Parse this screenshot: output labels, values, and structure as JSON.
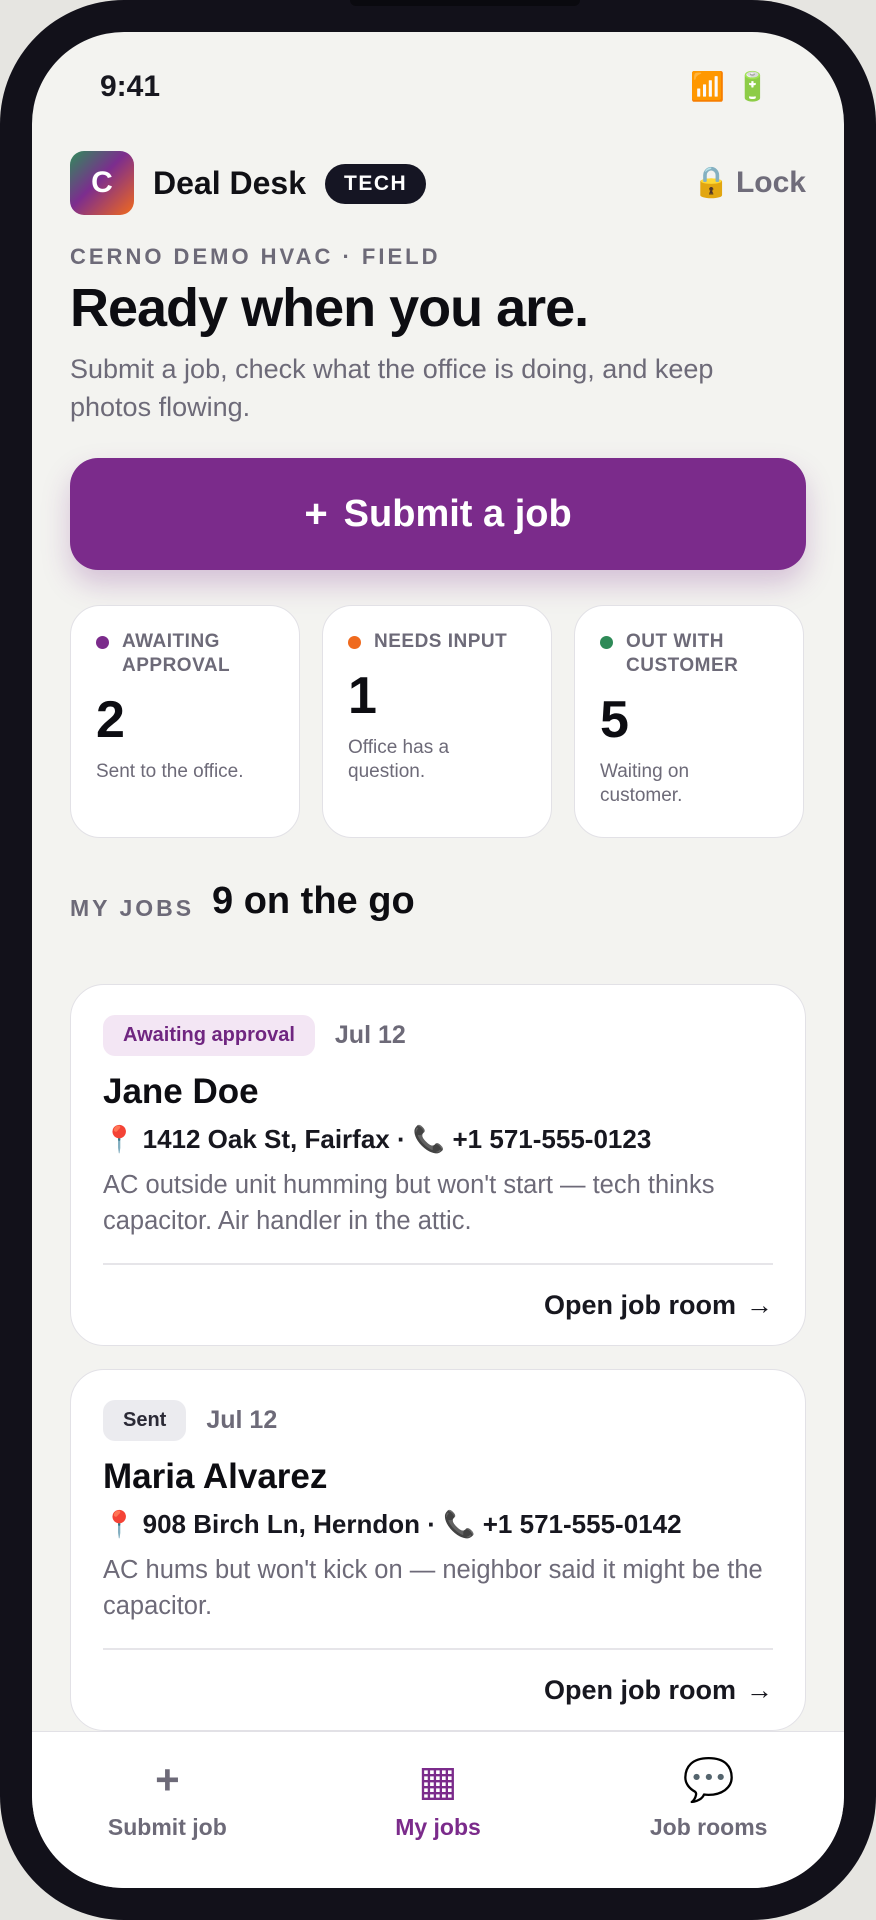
{
  "status_bar": {
    "time": "9:41",
    "wifi_icon": "📶",
    "battery_icon": "🔋"
  },
  "header": {
    "logo_letter": "C",
    "app_name": "Deal Desk",
    "role_badge": "TECH",
    "lock_icon": "🔒",
    "lock_label": "Lock"
  },
  "intro": {
    "eyebrow": "CERNO DEMO HVAC · FIELD",
    "title": "Ready when you are.",
    "subtitle": "Submit a job, check what the office is doing, and keep photos flowing."
  },
  "submit_button": {
    "icon": "+",
    "label": "Submit a job"
  },
  "stats": [
    {
      "label": "AWAITING APPROVAL",
      "value": "2",
      "description": "Sent to the office.",
      "dot_color": "#7b2b8b"
    },
    {
      "label": "NEEDS INPUT",
      "value": "1",
      "description": "Office has a question.",
      "dot_color": "#ef6a1e"
    },
    {
      "label": "OUT WITH CUSTOMER",
      "value": "5",
      "description": "Waiting on customer.",
      "dot_color": "#2e8a57"
    }
  ],
  "my_jobs": {
    "label": "MY JOBS",
    "title": "9 on the go",
    "jobs": [
      {
        "status": "Awaiting approval",
        "status_bg": "#f3e6f4",
        "status_color": "#6f2580",
        "date": "Jul 12",
        "customer": "Jane Doe",
        "pin_icon": "📍",
        "address": "1412 Oak St, Fairfax",
        "separator": "·",
        "phone_icon": "📞",
        "phone": "+1 571-555-0123",
        "description": "AC outside unit humming but won't start — tech thinks capacitor. Air handler in the attic.",
        "link_label": "Open job room",
        "link_arrow": "→"
      },
      {
        "status": "Sent",
        "status_bg": "#ebebef",
        "status_color": "#2b2a36",
        "date": "Jul 12",
        "customer": "Maria Alvarez",
        "pin_icon": "📍",
        "address": "908 Birch Ln, Herndon",
        "separator": "·",
        "phone_icon": "📞",
        "phone": "+1 571-555-0142",
        "description": "AC hums but won't kick on — neighbor said it might be the capacitor.",
        "link_label": "Open job room",
        "link_arrow": "→"
      }
    ]
  },
  "tab_bar": {
    "tabs": [
      {
        "icon": "+",
        "label": "Submit job",
        "color": "#6d6a78"
      },
      {
        "icon": "▦",
        "label": "My jobs",
        "color": "#7b2b8b"
      },
      {
        "icon": "💬",
        "label": "Job rooms",
        "color": "#6d6a78"
      }
    ]
  }
}
